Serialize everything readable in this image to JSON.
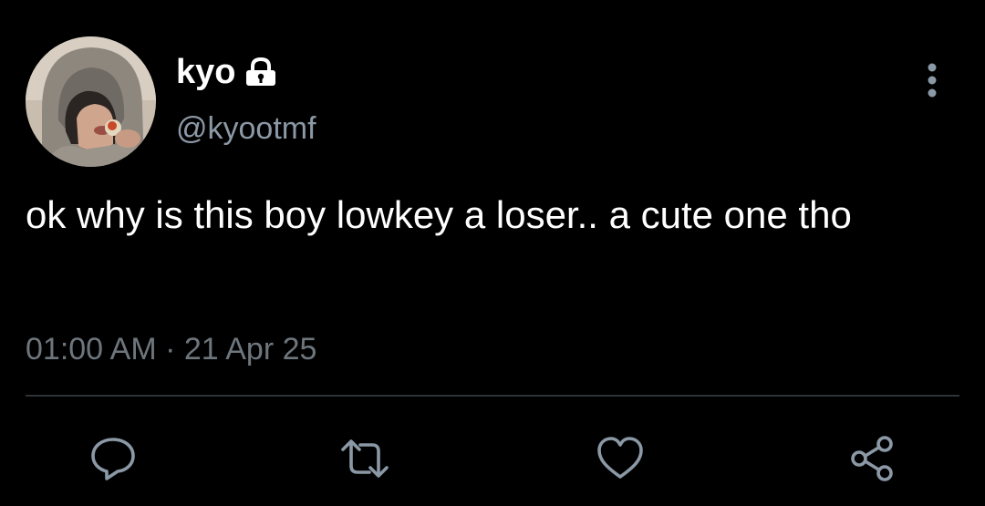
{
  "user": {
    "display_name": "kyo",
    "handle": "@kyootmf",
    "protected_icon": "lock-icon",
    "avatar": "profile-photo-avatar"
  },
  "tweet": {
    "text": "ok why is this boy lowkey a loser.. a cute one tho",
    "timestamp": "01:00 AM · 21 Apr 25"
  },
  "menu_icon": "more-vertical-icon",
  "actions": [
    {
      "name": "reply",
      "icon": "comment-icon"
    },
    {
      "name": "retweet",
      "icon": "retweet-icon"
    },
    {
      "name": "like",
      "icon": "heart-icon"
    },
    {
      "name": "share",
      "icon": "share-icon"
    }
  ],
  "colors": {
    "background": "#000000",
    "primary_text": "#ffffff",
    "secondary_text": "#8b98a5",
    "icon": "#8b98a5",
    "divider": "#2f3336"
  }
}
